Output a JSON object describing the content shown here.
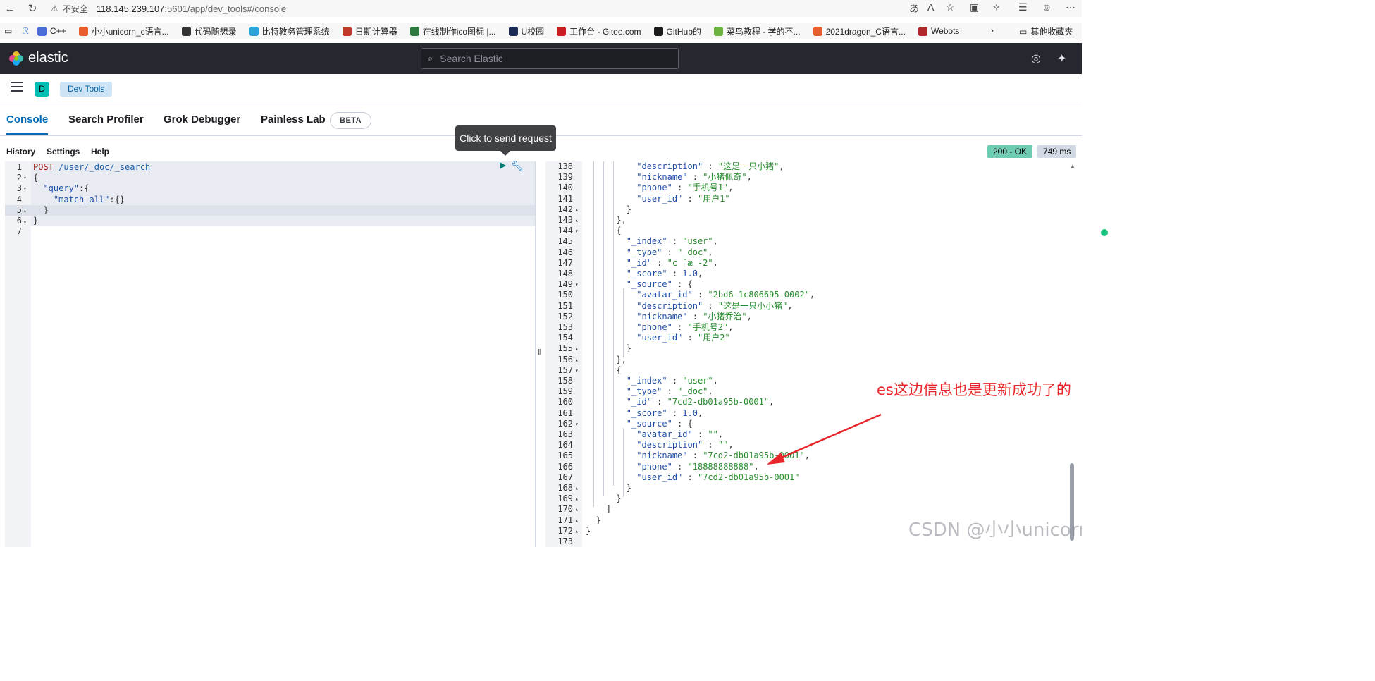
{
  "browser": {
    "security_label": "不安全",
    "url_host": "118.145.239.107",
    "url_path": ":5601/app/dev_tools#/console",
    "bookmarks": [
      {
        "label": "C++",
        "color": "#4b6cd6"
      },
      {
        "label": "小小unicorn_c语言...",
        "color": "#e85d2b"
      },
      {
        "label": "代码随想录",
        "color": "#333333"
      },
      {
        "label": "比特教务管理系统",
        "color": "#2aa4d8"
      },
      {
        "label": "日期计算器",
        "color": "#c0392b"
      },
      {
        "label": "在线制作ico图标 |...",
        "color": "#2c7a3f"
      },
      {
        "label": "U校园",
        "color": "#1b2a55"
      },
      {
        "label": "工作台 - Gitee.com",
        "color": "#c71d23"
      },
      {
        "label": "GitHub的",
        "color": "#1a1a1a"
      },
      {
        "label": "菜鸟教程 - 学的不...",
        "color": "#6cb33e"
      },
      {
        "label": "2021dragon_C语言...",
        "color": "#e85d2b"
      },
      {
        "label": "Webots",
        "color": "#b0272d"
      }
    ],
    "other_bookmarks": "其他收藏夹"
  },
  "header": {
    "brand": "elastic",
    "search_placeholder": "Search Elastic"
  },
  "breadcrumb": {
    "space_initial": "D",
    "current": "Dev Tools"
  },
  "tabs": {
    "console": "Console",
    "search_profiler": "Search Profiler",
    "grok_debugger": "Grok Debugger",
    "painless_lab": "Painless Lab",
    "beta": "BETA"
  },
  "tooltip": "Click to send request",
  "toolbar": {
    "history": "History",
    "settings": "Settings",
    "help": "Help",
    "status": "200 - OK",
    "timing": "749 ms"
  },
  "request_lines": [
    {
      "n": "1",
      "fold": "",
      "parts": [
        [
          "method",
          "POST"
        ],
        [
          "pun",
          " "
        ],
        [
          "urlc",
          "/user/_doc/_search"
        ]
      ]
    },
    {
      "n": "2",
      "fold": "▾",
      "parts": [
        [
          "pun",
          "{"
        ]
      ]
    },
    {
      "n": "3",
      "fold": "▾",
      "parts": [
        [
          "pun",
          "  "
        ],
        [
          "key",
          "\"query\""
        ],
        [
          "pun",
          ":{"
        ]
      ]
    },
    {
      "n": "4",
      "fold": "",
      "parts": [
        [
          "pun",
          "    "
        ],
        [
          "key",
          "\"match_all\""
        ],
        [
          "pun",
          ":{}"
        ]
      ]
    },
    {
      "n": "5",
      "fold": "▴",
      "parts": [
        [
          "pun",
          "  }"
        ]
      ]
    },
    {
      "n": "6",
      "fold": "▴",
      "parts": [
        [
          "pun",
          "}"
        ]
      ]
    },
    {
      "n": "7",
      "fold": "",
      "parts": []
    }
  ],
  "response_lines": [
    {
      "n": "138",
      "fold": "",
      "parts": [
        [
          "pun",
          "          "
        ],
        [
          "key",
          "\"description\""
        ],
        [
          "pun",
          " : "
        ],
        [
          "str",
          "\"这是一只小猪\""
        ],
        [
          "pun",
          ","
        ]
      ]
    },
    {
      "n": "139",
      "fold": "",
      "parts": [
        [
          "pun",
          "          "
        ],
        [
          "key",
          "\"nickname\""
        ],
        [
          "pun",
          " : "
        ],
        [
          "str",
          "\"小猪佩奇\""
        ],
        [
          "pun",
          ","
        ]
      ]
    },
    {
      "n": "140",
      "fold": "",
      "parts": [
        [
          "pun",
          "          "
        ],
        [
          "key",
          "\"phone\""
        ],
        [
          "pun",
          " : "
        ],
        [
          "str",
          "\"手机号1\""
        ],
        [
          "pun",
          ","
        ]
      ]
    },
    {
      "n": "141",
      "fold": "",
      "parts": [
        [
          "pun",
          "          "
        ],
        [
          "key",
          "\"user_id\""
        ],
        [
          "pun",
          " : "
        ],
        [
          "str",
          "\"用户1\""
        ]
      ]
    },
    {
      "n": "142",
      "fold": "▴",
      "parts": [
        [
          "pun",
          "        }"
        ]
      ]
    },
    {
      "n": "143",
      "fold": "▴",
      "parts": [
        [
          "pun",
          "      },"
        ]
      ]
    },
    {
      "n": "144",
      "fold": "▾",
      "parts": [
        [
          "pun",
          "      {"
        ]
      ]
    },
    {
      "n": "145",
      "fold": "",
      "parts": [
        [
          "pun",
          "        "
        ],
        [
          "key",
          "\"_index\""
        ],
        [
          "pun",
          " : "
        ],
        [
          "str",
          "\"user\""
        ],
        [
          "pun",
          ","
        ]
      ]
    },
    {
      "n": "146",
      "fold": "",
      "parts": [
        [
          "pun",
          "        "
        ],
        [
          "key",
          "\"_type\""
        ],
        [
          "pun",
          " : "
        ],
        [
          "str",
          "\"_doc\""
        ],
        [
          "pun",
          ","
        ]
      ]
    },
    {
      "n": "147",
      "fold": "",
      "parts": [
        [
          "pun",
          "        "
        ],
        [
          "key",
          "\"_id\""
        ],
        [
          "pun",
          " : "
        ],
        [
          "str",
          "\"c ¨æ -2\""
        ],
        [
          "pun",
          ","
        ]
      ]
    },
    {
      "n": "148",
      "fold": "",
      "parts": [
        [
          "pun",
          "        "
        ],
        [
          "key",
          "\"_score\""
        ],
        [
          "pun",
          " : "
        ],
        [
          "num",
          "1.0"
        ],
        [
          "pun",
          ","
        ]
      ]
    },
    {
      "n": "149",
      "fold": "▾",
      "parts": [
        [
          "pun",
          "        "
        ],
        [
          "key",
          "\"_source\""
        ],
        [
          "pun",
          " : {"
        ]
      ]
    },
    {
      "n": "150",
      "fold": "",
      "parts": [
        [
          "pun",
          "          "
        ],
        [
          "key",
          "\"avatar_id\""
        ],
        [
          "pun",
          " : "
        ],
        [
          "str",
          "\"2bd6-1c806695-0002\""
        ],
        [
          "pun",
          ","
        ]
      ]
    },
    {
      "n": "151",
      "fold": "",
      "parts": [
        [
          "pun",
          "          "
        ],
        [
          "key",
          "\"description\""
        ],
        [
          "pun",
          " : "
        ],
        [
          "str",
          "\"这是一只小小猪\""
        ],
        [
          "pun",
          ","
        ]
      ]
    },
    {
      "n": "152",
      "fold": "",
      "parts": [
        [
          "pun",
          "          "
        ],
        [
          "key",
          "\"nickname\""
        ],
        [
          "pun",
          " : "
        ],
        [
          "str",
          "\"小猪乔治\""
        ],
        [
          "pun",
          ","
        ]
      ]
    },
    {
      "n": "153",
      "fold": "",
      "parts": [
        [
          "pun",
          "          "
        ],
        [
          "key",
          "\"phone\""
        ],
        [
          "pun",
          " : "
        ],
        [
          "str",
          "\"手机号2\""
        ],
        [
          "pun",
          ","
        ]
      ]
    },
    {
      "n": "154",
      "fold": "",
      "parts": [
        [
          "pun",
          "          "
        ],
        [
          "key",
          "\"user_id\""
        ],
        [
          "pun",
          " : "
        ],
        [
          "str",
          "\"用户2\""
        ]
      ]
    },
    {
      "n": "155",
      "fold": "▴",
      "parts": [
        [
          "pun",
          "        }"
        ]
      ]
    },
    {
      "n": "156",
      "fold": "▴",
      "parts": [
        [
          "pun",
          "      },"
        ]
      ]
    },
    {
      "n": "157",
      "fold": "▾",
      "parts": [
        [
          "pun",
          "      {"
        ]
      ]
    },
    {
      "n": "158",
      "fold": "",
      "parts": [
        [
          "pun",
          "        "
        ],
        [
          "key",
          "\"_index\""
        ],
        [
          "pun",
          " : "
        ],
        [
          "str",
          "\"user\""
        ],
        [
          "pun",
          ","
        ]
      ]
    },
    {
      "n": "159",
      "fold": "",
      "parts": [
        [
          "pun",
          "        "
        ],
        [
          "key",
          "\"_type\""
        ],
        [
          "pun",
          " : "
        ],
        [
          "str",
          "\"_doc\""
        ],
        [
          "pun",
          ","
        ]
      ]
    },
    {
      "n": "160",
      "fold": "",
      "parts": [
        [
          "pun",
          "        "
        ],
        [
          "key",
          "\"_id\""
        ],
        [
          "pun",
          " : "
        ],
        [
          "str",
          "\"7cd2-db01a95b-0001\""
        ],
        [
          "pun",
          ","
        ]
      ]
    },
    {
      "n": "161",
      "fold": "",
      "parts": [
        [
          "pun",
          "        "
        ],
        [
          "key",
          "\"_score\""
        ],
        [
          "pun",
          " : "
        ],
        [
          "num",
          "1.0"
        ],
        [
          "pun",
          ","
        ]
      ]
    },
    {
      "n": "162",
      "fold": "▾",
      "parts": [
        [
          "pun",
          "        "
        ],
        [
          "key",
          "\"_source\""
        ],
        [
          "pun",
          " : {"
        ]
      ]
    },
    {
      "n": "163",
      "fold": "",
      "parts": [
        [
          "pun",
          "          "
        ],
        [
          "key",
          "\"avatar_id\""
        ],
        [
          "pun",
          " : "
        ],
        [
          "str",
          "\"\""
        ],
        [
          "pun",
          ","
        ]
      ]
    },
    {
      "n": "164",
      "fold": "",
      "parts": [
        [
          "pun",
          "          "
        ],
        [
          "key",
          "\"description\""
        ],
        [
          "pun",
          " : "
        ],
        [
          "str",
          "\"\""
        ],
        [
          "pun",
          ","
        ]
      ]
    },
    {
      "n": "165",
      "fold": "",
      "parts": [
        [
          "pun",
          "          "
        ],
        [
          "key",
          "\"nickname\""
        ],
        [
          "pun",
          " : "
        ],
        [
          "str",
          "\"7cd2-db01a95b-0001\""
        ],
        [
          "pun",
          ","
        ]
      ]
    },
    {
      "n": "166",
      "fold": "",
      "parts": [
        [
          "pun",
          "          "
        ],
        [
          "key",
          "\"phone\""
        ],
        [
          "pun",
          " : "
        ],
        [
          "str",
          "\"18888888888\""
        ],
        [
          "pun",
          ","
        ]
      ]
    },
    {
      "n": "167",
      "fold": "",
      "parts": [
        [
          "pun",
          "          "
        ],
        [
          "key",
          "\"user_id\""
        ],
        [
          "pun",
          " : "
        ],
        [
          "str",
          "\"7cd2-db01a95b-0001\""
        ]
      ]
    },
    {
      "n": "168",
      "fold": "▴",
      "parts": [
        [
          "pun",
          "        }"
        ]
      ]
    },
    {
      "n": "169",
      "fold": "▴",
      "parts": [
        [
          "pun",
          "      }"
        ]
      ]
    },
    {
      "n": "170",
      "fold": "▴",
      "parts": [
        [
          "pun",
          "    ]"
        ]
      ]
    },
    {
      "n": "171",
      "fold": "▴",
      "parts": [
        [
          "pun",
          "  }"
        ]
      ]
    },
    {
      "n": "172",
      "fold": "▴",
      "parts": [
        [
          "pun",
          "}"
        ]
      ]
    },
    {
      "n": "173",
      "fold": "",
      "parts": []
    }
  ],
  "annotation": "es这边信息也是更新成功了的",
  "watermark": "CSDN @小小unicorn",
  "colors": {
    "header_bg": "#25282f",
    "accent": "#006bb8",
    "status_ok": "#6dccb1",
    "annotation_red": "#e8262a"
  }
}
